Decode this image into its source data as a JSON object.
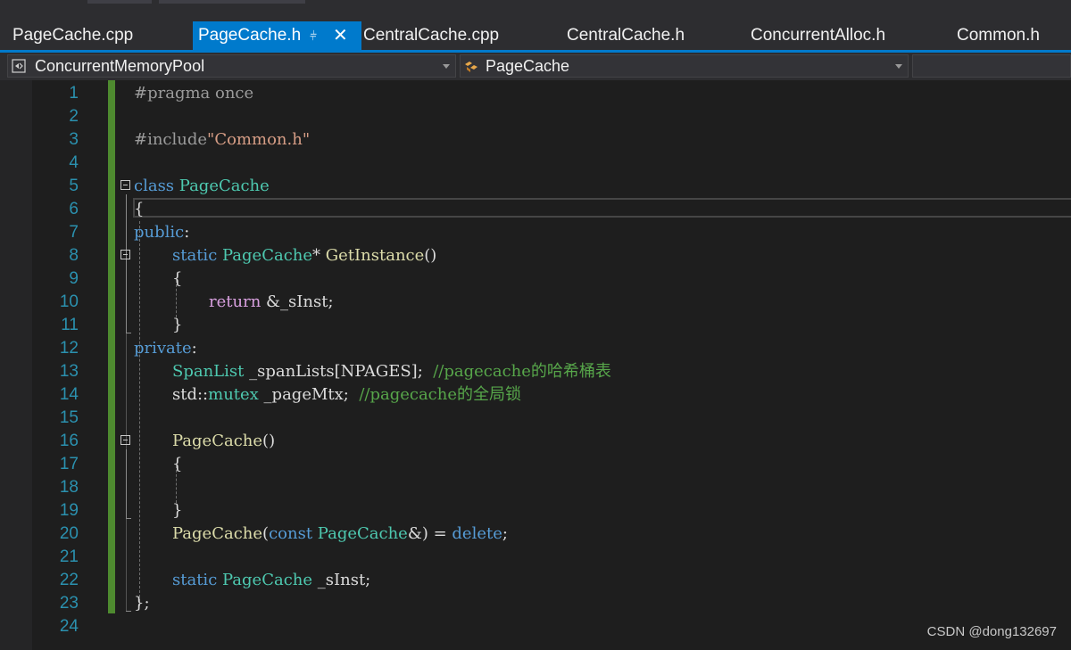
{
  "tabs": [
    {
      "label": "PageCache.cpp",
      "active": false
    },
    {
      "label": "PageCache.h",
      "active": true
    },
    {
      "label": "CentralCache.cpp",
      "active": false
    },
    {
      "label": "CentralCache.h",
      "active": false
    },
    {
      "label": "ConcurrentAlloc.h",
      "active": false
    },
    {
      "label": "Common.h",
      "active": false
    }
  ],
  "icons": {
    "pin": "pin-icon",
    "close": "close-icon",
    "project": "project-icon",
    "class": "class-icon"
  },
  "navbar": {
    "project": "ConcurrentMemoryPool",
    "scope": "PageCache",
    "member": ""
  },
  "code": {
    "lines": [
      "1",
      "2",
      "3",
      "4",
      "5",
      "6",
      "7",
      "8",
      "9",
      "10",
      "11",
      "12",
      "13",
      "14",
      "15",
      "16",
      "17",
      "18",
      "19",
      "20",
      "21",
      "22",
      "23",
      "24"
    ],
    "tokens": {
      "l1": "#pragma once",
      "l3_a": "#include",
      "l3_b": "\"Common.h\"",
      "l5_a": "class ",
      "l5_b": "PageCache",
      "l6": "{",
      "l7_a": "public",
      "l7_b": ":",
      "l8_a": "static ",
      "l8_b": "PageCache",
      "l8_c": "* ",
      "l8_d": "GetInstance",
      "l8_e": "()",
      "l9": "{",
      "l10_a": "return ",
      "l10_b": "&_sInst;",
      "l11": "}",
      "l12_a": "private",
      "l12_b": ":",
      "l13_a": "SpanList ",
      "l13_b": "_spanLists[NPAGES];  ",
      "l13_c": "//pagecache的哈希桶表",
      "l14_a": "std::",
      "l14_b": "mutex ",
      "l14_c": "_pageMtx;  ",
      "l14_d": "//pagecache的全局锁",
      "l16_a": "PageCache",
      "l16_b": "()",
      "l17": "{",
      "l19": "}",
      "l20_a": "PageCache",
      "l20_b": "(",
      "l20_c": "const ",
      "l20_d": "PageCache",
      "l20_e": "&) = ",
      "l20_f": "delete",
      "l20_g": ";",
      "l22_a": "static ",
      "l22_b": "PageCache ",
      "l22_c": "_sInst;",
      "l23": "};"
    }
  },
  "watermark": "CSDN @dong132697"
}
